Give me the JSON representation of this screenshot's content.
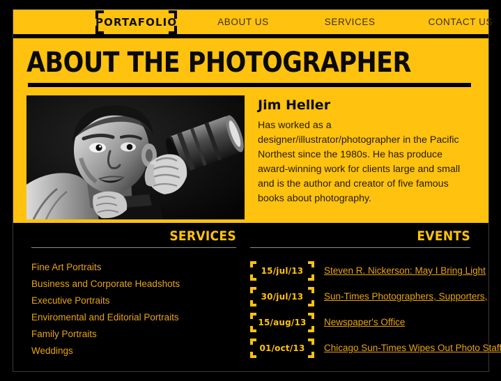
{
  "colors": {
    "brand_yellow": "#FFC20E",
    "link_gold": "#E8A317",
    "background_black": "#000000",
    "nav_text": "#3b3020"
  },
  "nav": {
    "logo": "PORTAFOLIO",
    "links": [
      {
        "label": "ABOUT US"
      },
      {
        "label": "SERVICES"
      },
      {
        "label": "CONTACT US"
      }
    ]
  },
  "hero": {
    "title": "ABOUT THE PHOTOGRAPHER",
    "photo_alt": "black and white portrait of photographer holding camera with telephoto lens",
    "bio": {
      "name": "Jim Heller",
      "text": "Has worked as a designer/illustrator/photographer in the Pacific Northest since the 1980s. He has produce award-winning work for clients large and small and is the author and creator of five famous books about photography."
    }
  },
  "services": {
    "heading": "SERVICES",
    "items": [
      {
        "label": "Fine Art Portraits"
      },
      {
        "label": "Business and Corporate Headshots"
      },
      {
        "label": "Executive Portraits"
      },
      {
        "label": "Enviromental and Editorial Portraits"
      },
      {
        "label": "Family Portraits"
      },
      {
        "label": "Weddings"
      }
    ]
  },
  "events": {
    "heading": "EVENTS",
    "items": [
      {
        "date": "15/jul/13",
        "title": "Steven R. Nickerson: May I Bring Light"
      },
      {
        "date": "30/jul/13",
        "title": "Sun-Times Photographers, Supporters,"
      },
      {
        "date": "15/aug/13",
        "title": "Newspaper's Office"
      },
      {
        "date": "01/oct/13",
        "title": "Chicago Sun-Times Wipes Out Photo Staff"
      }
    ]
  }
}
